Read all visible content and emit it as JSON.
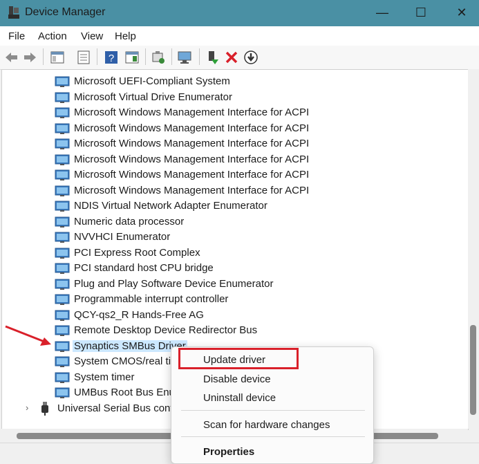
{
  "window": {
    "title": "Device Manager",
    "minimize": "—",
    "maximize": "☐",
    "close": "✕"
  },
  "menu": [
    "File",
    "Action",
    "View",
    "Help"
  ],
  "toolbar": {
    "icons": [
      "back-icon",
      "forward-icon",
      "show-hide-tree-icon",
      "properties-icon",
      "help-icon",
      "action-pane-icon",
      "update-driver-icon",
      "scan-hardware-icon",
      "enable-device-icon",
      "uninstall-icon",
      "download-icon"
    ]
  },
  "devices": [
    "Microsoft UEFI-Compliant System",
    "Microsoft Virtual Drive Enumerator",
    "Microsoft Windows Management Interface for ACPI",
    "Microsoft Windows Management Interface for ACPI",
    "Microsoft Windows Management Interface for ACPI",
    "Microsoft Windows Management Interface for ACPI",
    "Microsoft Windows Management Interface for ACPI",
    "Microsoft Windows Management Interface for ACPI",
    "NDIS Virtual Network Adapter Enumerator",
    "Numeric data processor",
    "NVVHCI Enumerator",
    "PCI Express Root Complex",
    "PCI standard host CPU bridge",
    "Plug and Play Software Device Enumerator",
    "Programmable interrupt controller",
    "QCY-qs2_R Hands-Free AG",
    "Remote Desktop Device Redirector Bus",
    "Synaptics SMBus Driver",
    "System CMOS/real tim",
    "System timer",
    "UMBus Root Bus Enur"
  ],
  "selected_device": "Synaptics SMBus Driver",
  "category": {
    "label": "Universal Serial Bus contro",
    "expander": "›"
  },
  "context_menu": {
    "update": "Update driver",
    "disable": "Disable device",
    "uninstall": "Uninstall device",
    "scan": "Scan for hardware changes",
    "properties": "Properties"
  },
  "colors": {
    "titlebar": "#4a90a4",
    "selection": "#cce8ff",
    "annotation": "#d9202a"
  }
}
